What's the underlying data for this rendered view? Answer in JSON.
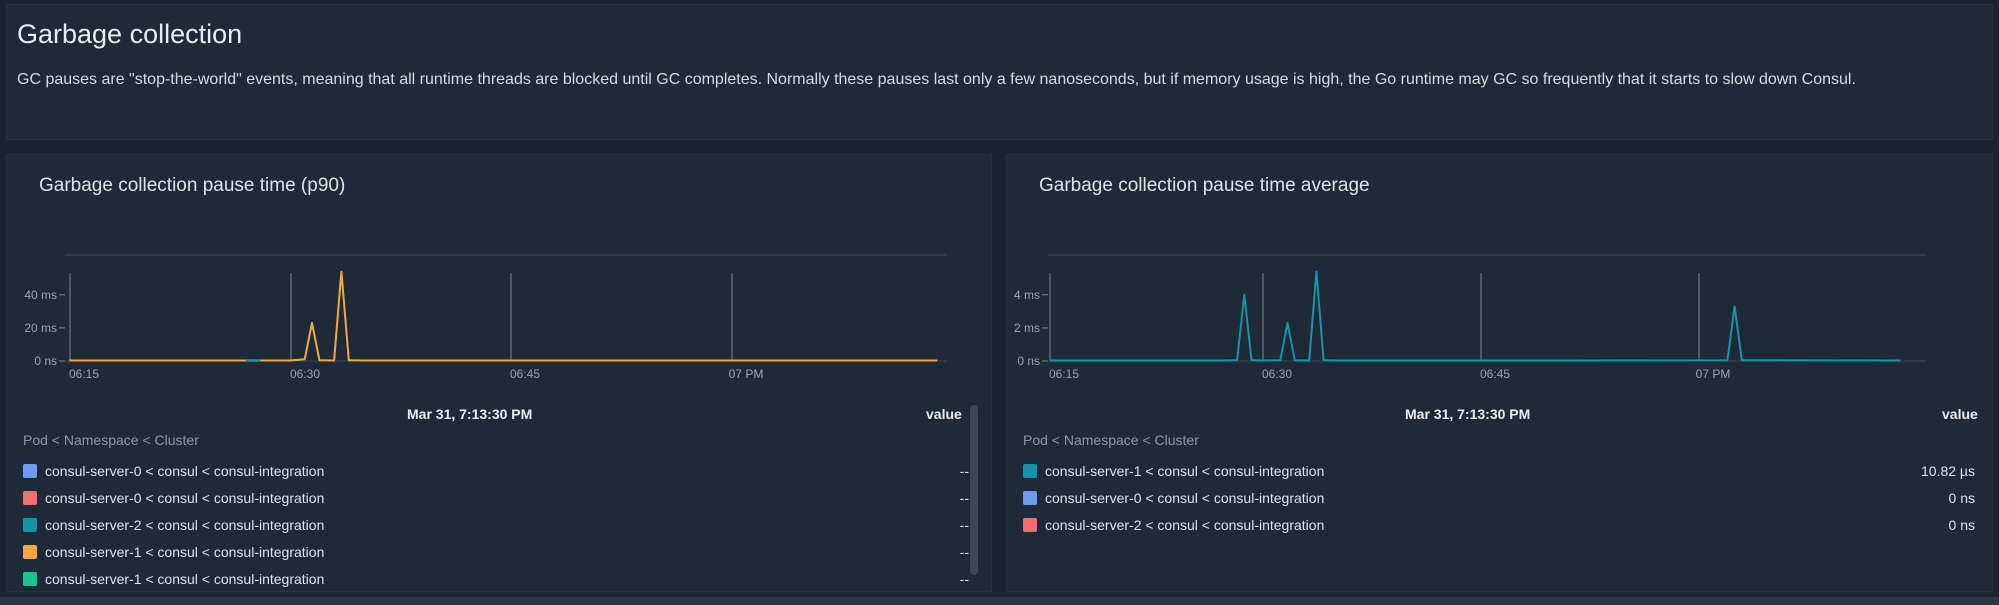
{
  "header": {
    "title": "Garbage collection",
    "description": "GC pauses are \"stop-the-world\" events, meaning that all runtime threads are blocked until GC completes. Normally these pauses last only a few nanoseconds, but if memory usage is high, the Go runtime may GC so frequently that it starts to slow down Consul."
  },
  "panels": [
    {
      "title": "Garbage collection pause time (p90)",
      "hover_date": "Mar 31, 7:13:30 PM",
      "value_header": "value",
      "legend_header": "Pod < Namespace < Cluster",
      "legend": [
        {
          "label": "consul-server-0 < consul < consul-integration",
          "value": "--",
          "color": "#6d9cf2"
        },
        {
          "label": "consul-server-0 < consul < consul-integration",
          "value": "--",
          "color": "#f07070"
        },
        {
          "label": "consul-server-2 < consul < consul-integration",
          "value": "--",
          "color": "#1894a8"
        },
        {
          "label": "consul-server-1 < consul < consul-integration",
          "value": "--",
          "color": "#f5a742"
        },
        {
          "label": "consul-server-1 < consul < consul-integration",
          "value": "--",
          "color": "#20c08c"
        }
      ]
    },
    {
      "title": "Garbage collection pause time average",
      "hover_date": "Mar 31, 7:13:30 PM",
      "value_header": "value",
      "legend_header": "Pod < Namespace < Cluster",
      "legend": [
        {
          "label": "consul-server-1 < consul < consul-integration",
          "value": "10.82 µs",
          "color": "#1894a8"
        },
        {
          "label": "consul-server-0 < consul < consul-integration",
          "value": "0 ns",
          "color": "#6d9cf2"
        },
        {
          "label": "consul-server-2 < consul < consul-integration",
          "value": "0 ns",
          "color": "#f07070"
        }
      ]
    }
  ],
  "chart_data": [
    {
      "type": "line",
      "title": "Garbage collection pause time (p90)",
      "x_ticks": [
        "06:15",
        "06:30",
        "06:45",
        "07 PM"
      ],
      "y_ticks": [
        "0 ns",
        "20 ms",
        "40 ms"
      ],
      "y_unit": "ms",
      "ylim": [
        0,
        58
      ],
      "xlim": [
        "06:14",
        "07:13"
      ],
      "series": [
        {
          "name": "consul-server-1 < consul < consul-integration",
          "color": "#f5a742",
          "x": [
            "06:14",
            "06:20",
            "06:29",
            "06:30",
            "06:30.5",
            "06:31",
            "06:32",
            "06:32.5",
            "06:33",
            "06:34",
            "06:45",
            "07:00",
            "07:13"
          ],
          "values": [
            0.3,
            0.3,
            0.3,
            1,
            23,
            0.5,
            0.3,
            54,
            0.5,
            0.3,
            0.3,
            0.3,
            0.3
          ]
        },
        {
          "name": "consul-server-2 < consul < consul-integration",
          "color": "#1894a8",
          "x": [
            "06:26",
            "06:27"
          ],
          "values": [
            0.5,
            0.5
          ]
        }
      ],
      "annotation_lines": [
        "06:15",
        "06:30",
        "06:45",
        "07 PM"
      ]
    },
    {
      "type": "line",
      "title": "Garbage collection pause time average",
      "x_ticks": [
        "06:15",
        "06:30",
        "06:45",
        "07 PM"
      ],
      "y_ticks": [
        "0 ns",
        "2 ms",
        "4 ms"
      ],
      "y_unit": "ms",
      "ylim": [
        0,
        5.8
      ],
      "xlim": [
        "06:14",
        "07:13"
      ],
      "series": [
        {
          "name": "consul-server-1 < consul < consul-integration",
          "color": "#1894a8",
          "x": [
            "06:14",
            "06:26",
            "06:27",
            "06:27.5",
            "06:28",
            "06:29",
            "06:30",
            "06:30.5",
            "06:31",
            "06:32",
            "06:32.5",
            "06:33",
            "06:34",
            "06:50",
            "07:01",
            "07:01.5",
            "07:02",
            "07:13"
          ],
          "values": [
            0.03,
            0.03,
            0.05,
            4.0,
            0.05,
            0.03,
            0.05,
            2.3,
            0.05,
            0.03,
            5.4,
            0.05,
            0.03,
            0.03,
            0.05,
            3.3,
            0.05,
            0.03
          ]
        }
      ],
      "annotation_lines": [
        "06:15",
        "06:30",
        "06:45",
        "07 PM"
      ]
    }
  ]
}
